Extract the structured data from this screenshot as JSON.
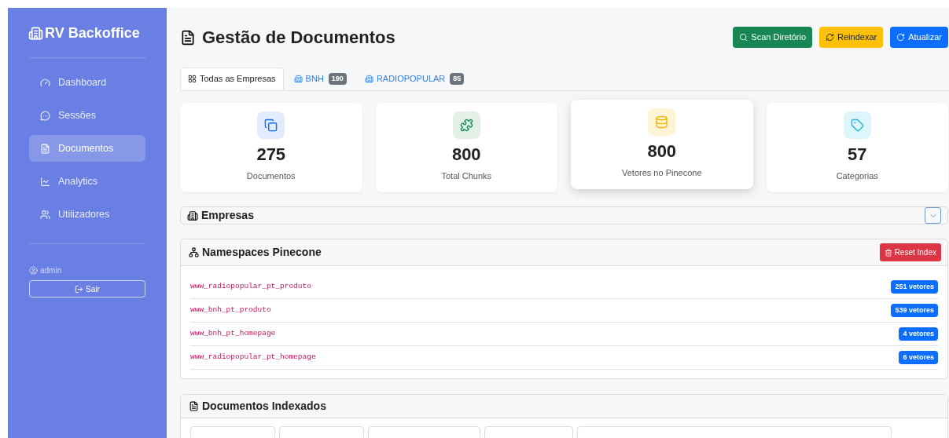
{
  "sidebar": {
    "brand": "RV Backoffice",
    "items": [
      {
        "label": "Dashboard",
        "kind": "gauge",
        "selected": false
      },
      {
        "label": "Sessões",
        "kind": "chat",
        "selected": false
      },
      {
        "label": "Documentos",
        "kind": "file",
        "selected": true
      },
      {
        "label": "Analytics",
        "kind": "chart",
        "selected": false
      },
      {
        "label": "Utilizadores",
        "kind": "users",
        "selected": false
      }
    ],
    "user": "admin",
    "logout": "Sair"
  },
  "header": {
    "title": "Gestão de Documentos",
    "buttons": [
      {
        "label": "Scan Diretório",
        "kind": "scan"
      },
      {
        "label": "Reindexar",
        "kind": "reindex"
      },
      {
        "label": "Atualizar",
        "kind": "refresh"
      }
    ]
  },
  "tabs": [
    {
      "label": "Todas as Empresas",
      "kind": "all",
      "selected": true
    },
    {
      "label": "BNH",
      "kind": "company",
      "count": "190",
      "selected": false
    },
    {
      "label": "RADIOPOPULAR",
      "kind": "company",
      "count": "85",
      "selected": false
    }
  ],
  "stats": [
    {
      "value": "275",
      "label": "Documentos",
      "kind": "documents",
      "raised": false
    },
    {
      "value": "800",
      "label": "Total Chunks",
      "kind": "chunks",
      "raised": false
    },
    {
      "value": "800",
      "label": "Vetores no Pinecone",
      "kind": "vectors",
      "raised": true
    },
    {
      "value": "57",
      "label": "Categorias",
      "kind": "categories",
      "raised": false
    }
  ],
  "empresas": {
    "title": "Empresas",
    "expanded": false
  },
  "namespaces": {
    "title": "Namespaces Pinecone",
    "reset_button": "Reset Index",
    "rows": [
      {
        "name": "www_radiopopular_pt_produto",
        "count": "251 vetores"
      },
      {
        "name": "www_bnh_pt_produto",
        "count": "539 vetores"
      },
      {
        "name": "www_bnh_pt_homepage",
        "count": "4 vetores"
      },
      {
        "name": "www_radiopopular_pt_homepage",
        "count": "6 vetores"
      }
    ]
  },
  "documents": {
    "title": "Documentos Indexados"
  }
}
